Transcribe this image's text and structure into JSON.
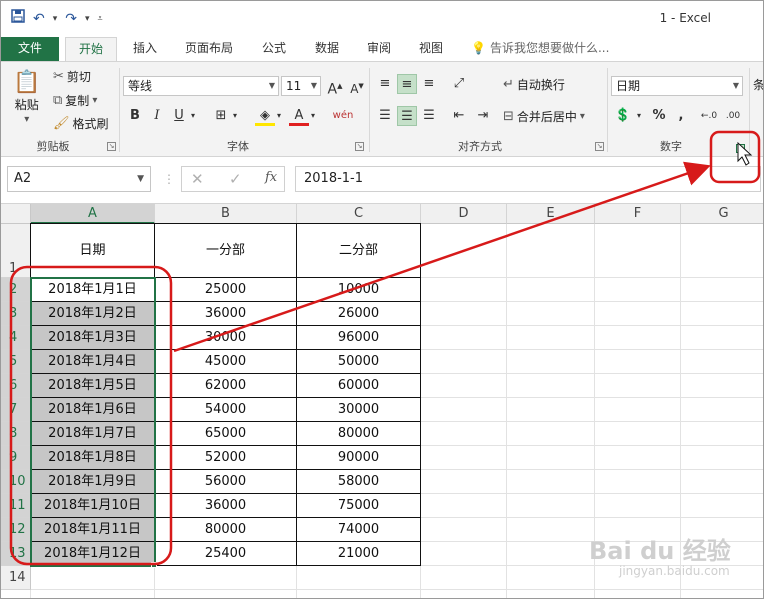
{
  "window": {
    "title": "1 - Excel"
  },
  "qat": {
    "save_icon": "save-icon",
    "undo_icon": "undo-icon",
    "redo_icon": "redo-icon"
  },
  "tabs": [
    "文件",
    "开始",
    "插入",
    "页面布局",
    "公式",
    "数据",
    "审阅",
    "视图"
  ],
  "active_tab": "开始",
  "tell_me": "告诉我您想要做什么...",
  "clipboard": {
    "paste": "粘贴",
    "cut": "剪切",
    "copy": "复制",
    "format_painter": "格式刷",
    "group": "剪贴板"
  },
  "font": {
    "name": "等线",
    "size": "11",
    "bold": "B",
    "italic": "I",
    "underline": "U",
    "phonetic": "wén",
    "group": "字体"
  },
  "alignment": {
    "wrap_text": "自动换行",
    "merge_center": "合并后居中",
    "group": "对齐方式"
  },
  "number": {
    "format": "日期",
    "percent": "%",
    "comma": ",",
    "group": "数字",
    "next_group_partial": "条"
  },
  "formula_bar": {
    "name_box": "A2",
    "fx": "fx",
    "content": "2018-1-1"
  },
  "columns": [
    "A",
    "B",
    "C",
    "D",
    "E",
    "F",
    "G"
  ],
  "rows": [
    "1",
    "2",
    "3",
    "4",
    "5",
    "6",
    "7",
    "8",
    "9",
    "10",
    "11",
    "12",
    "13",
    "14"
  ],
  "table": {
    "headers": [
      "日期",
      "一分部",
      "二分部"
    ],
    "rows": [
      [
        "2018年1月1日",
        "25000",
        "10000"
      ],
      [
        "2018年1月2日",
        "36000",
        "26000"
      ],
      [
        "2018年1月3日",
        "30000",
        "96000"
      ],
      [
        "2018年1月4日",
        "45000",
        "50000"
      ],
      [
        "2018年1月5日",
        "62000",
        "60000"
      ],
      [
        "2018年1月6日",
        "54000",
        "30000"
      ],
      [
        "2018年1月7日",
        "65000",
        "80000"
      ],
      [
        "2018年1月8日",
        "52000",
        "90000"
      ],
      [
        "2018年1月9日",
        "56000",
        "58000"
      ],
      [
        "2018年1月10日",
        "36000",
        "75000"
      ],
      [
        "2018年1月11日",
        "80000",
        "74000"
      ],
      [
        "2018年1月12日",
        "25400",
        "21000"
      ]
    ]
  },
  "colors": {
    "excel_green": "#217346",
    "annotation_red": "#d71a1a",
    "selection_gray": "#c6c6c6"
  },
  "watermark": {
    "brand": "Bai du 经验",
    "url": "jingyan.baidu.com"
  }
}
